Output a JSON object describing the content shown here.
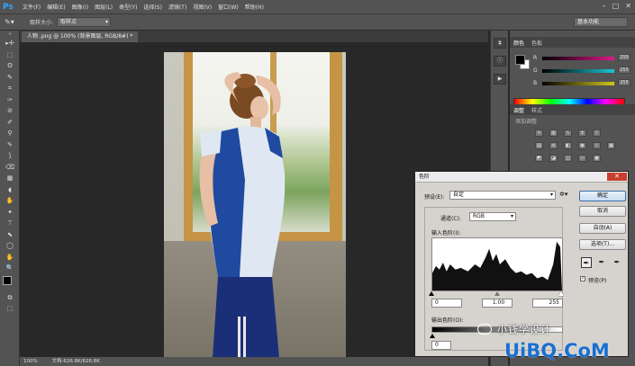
{
  "app": {
    "logo": "Ps"
  },
  "menu": [
    "文件(F)",
    "编辑(E)",
    "图像(I)",
    "图层(L)",
    "类型(Y)",
    "选择(S)",
    "滤镜(T)",
    "视图(V)",
    "窗口(W)",
    "帮助(H)"
  ],
  "window_controls": {
    "minimize": "–",
    "restore": "□",
    "close": "✕"
  },
  "options_bar": {
    "sample_size_label": "取样大小:",
    "sample_size_value": "取样点",
    "workspace": "基本功能"
  },
  "document": {
    "tab_title": "人物 .png @ 100% (背景图层, RGB/8#) *",
    "zoom": "100%",
    "doc_info": "文档:626.8K/626.8K"
  },
  "tools": [
    "▸✢",
    "⬚",
    "ʘ",
    "✎",
    "⌗",
    "✑",
    "⊘",
    "✐",
    "⚲",
    "✎",
    "⟆",
    "⌫",
    "▦",
    "◖",
    "✋",
    "✦",
    "⊤",
    "⬉",
    "◯",
    "✋",
    "🔍",
    "⧉",
    "⬚"
  ],
  "panels": {
    "color_tabs": [
      "颜色",
      "色板"
    ],
    "color": {
      "fg": "#000000",
      "bg": "#ffffff",
      "rows": [
        {
          "label": "R",
          "value": "255",
          "color": "#e0198b"
        },
        {
          "label": "G",
          "value": "255",
          "color": "#19c7d2"
        },
        {
          "label": "B",
          "value": "255",
          "color": "#d6c719"
        }
      ]
    },
    "adjust_tabs": [
      "调整",
      "样式"
    ],
    "adjust_title": "添加调整"
  },
  "levels": {
    "title": "色阶",
    "preset_label": "预设(E):",
    "preset_value": "自定",
    "channel_label": "通道(C):",
    "channel_value": "RGB",
    "input_label": "输入色阶(I):",
    "output_label": "输出色阶(O):",
    "input_values": [
      "0",
      "1.00",
      "255"
    ],
    "output_values": [
      "0",
      "255"
    ],
    "buttons": {
      "ok": "确定",
      "cancel": "取消",
      "auto": "自动(A)",
      "options": "选项(T)..."
    },
    "preview_label": "预览(P)",
    "preview_checked": "✓"
  },
  "watermark": {
    "brand": "小钱学设计",
    "logo": "UiBQ.CoM"
  }
}
